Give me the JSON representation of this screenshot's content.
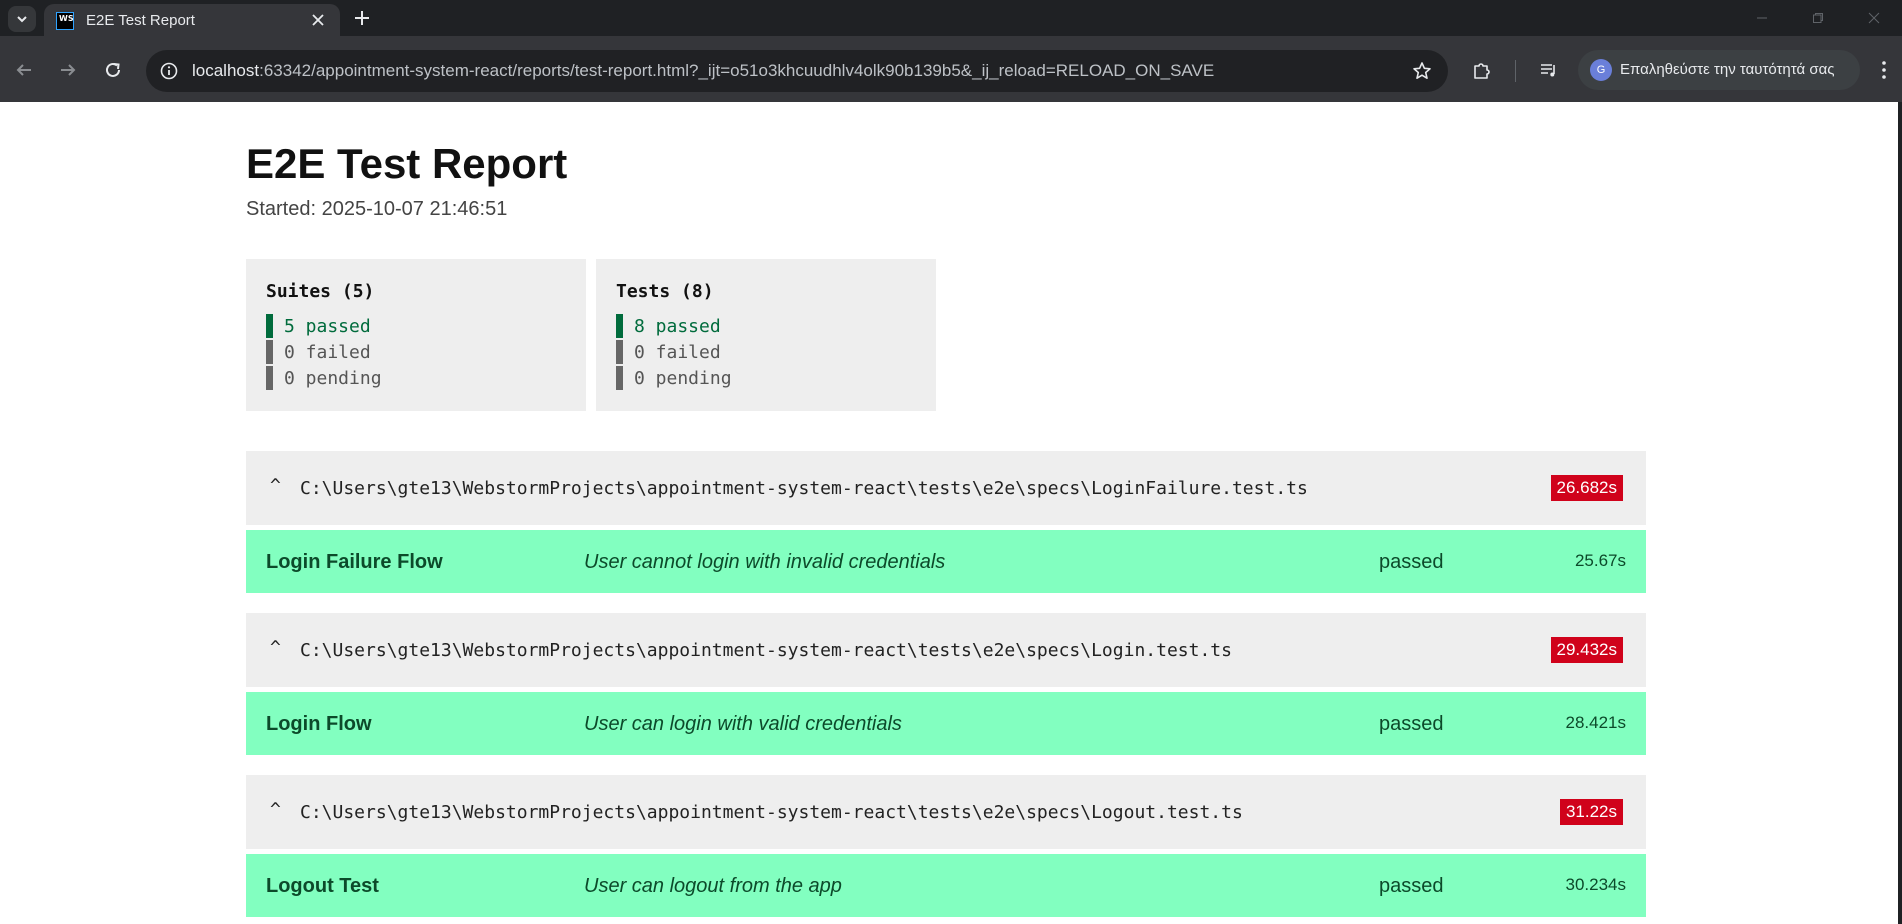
{
  "browser": {
    "tab_title": "E2E Test Report",
    "favicon_text": "WS",
    "url_host": "localhost",
    "url_rest": ":63342/appointment-system-react/reports/test-report.html?_ijt=o51o3khcuudhlv4olk90b139b5&_ij_reload=RELOAD_ON_SAVE",
    "profile_initial": "G",
    "profile_label": "Επαληθεύστε την ταυτότητά σας"
  },
  "report": {
    "title": "E2E Test Report",
    "started_label": "Started: ",
    "started_value": "2025-10-07 21:46:51"
  },
  "summary": {
    "suites": {
      "title": "Suites (5)",
      "passed": "5 passed",
      "failed": "0 failed",
      "pending": "0 pending"
    },
    "tests": {
      "title": "Tests (8)",
      "passed": "8 passed",
      "failed": "0 failed",
      "pending": "0 pending"
    }
  },
  "suites": [
    {
      "caret": "^",
      "path": "C:\\Users\\gte13\\WebstormProjects\\appointment-system-react\\tests\\e2e\\specs\\LoginFailure.test.ts",
      "duration": "26.682s",
      "test": {
        "suite_name": "Login Failure Flow",
        "description": "User cannot login with invalid credentials",
        "status": "passed",
        "duration": "25.67s"
      }
    },
    {
      "caret": "^",
      "path": "C:\\Users\\gte13\\WebstormProjects\\appointment-system-react\\tests\\e2e\\specs\\Login.test.ts",
      "duration": "29.432s",
      "test": {
        "suite_name": "Login Flow",
        "description": "User can login with valid credentials",
        "status": "passed",
        "duration": "28.421s"
      }
    },
    {
      "caret": "^",
      "path": "C:\\Users\\gte13\\WebstormProjects\\appointment-system-react\\tests\\e2e\\specs\\Logout.test.ts",
      "duration": "31.22s",
      "test": {
        "suite_name": "Logout Test",
        "description": "User can logout from the app",
        "status": "passed",
        "duration": "30.234s"
      }
    }
  ],
  "colors": {
    "passed_bg": "#82ffc0",
    "duration_badge": "#d0021b",
    "passed_text": "#006b3c"
  }
}
